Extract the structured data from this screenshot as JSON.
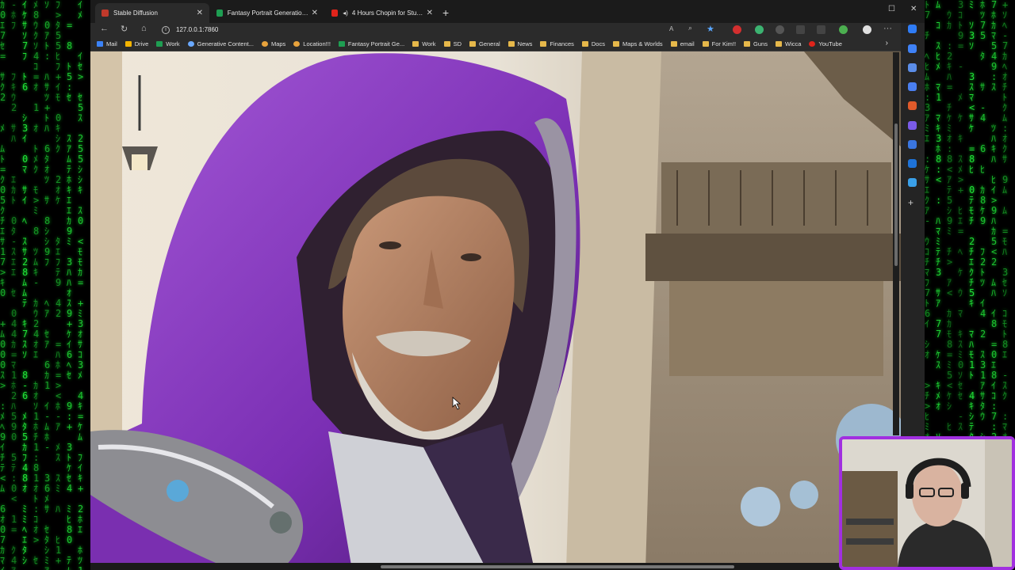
{
  "browser": {
    "tabs": [
      {
        "label": "Stable Diffusion",
        "active": true,
        "favicon": "stable-diffusion-icon"
      },
      {
        "label": "Fantasy Portrait Generation - Go...",
        "active": false,
        "favicon": "sheets-icon"
      },
      {
        "label": "4 Hours Chopin for Studyin...",
        "active": false,
        "favicon": "youtube-icon"
      }
    ],
    "new_tab_label": "+",
    "address": "127.0.0.1:7860",
    "bookmarks": [
      {
        "label": "Mail",
        "icon": "mail-icon"
      },
      {
        "label": "Drive",
        "icon": "drive-icon"
      },
      {
        "label": "Work",
        "icon": "sheets-icon"
      },
      {
        "label": "Generative Content...",
        "icon": "globe-icon"
      },
      {
        "label": "Maps",
        "icon": "maps-icon"
      },
      {
        "label": "Location!!!",
        "icon": "maps-icon"
      },
      {
        "label": "Fantasy Portrait Ge...",
        "icon": "sheets-icon"
      },
      {
        "label": "Work",
        "icon": "folder-icon"
      },
      {
        "label": "SD",
        "icon": "folder-icon"
      },
      {
        "label": "General",
        "icon": "folder-icon"
      },
      {
        "label": "News",
        "icon": "folder-icon"
      },
      {
        "label": "Finances",
        "icon": "folder-icon"
      },
      {
        "label": "Docs",
        "icon": "folder-icon"
      },
      {
        "label": "Maps & Worlds",
        "icon": "folder-icon"
      },
      {
        "label": "email",
        "icon": "folder-icon"
      },
      {
        "label": "For Kim!!",
        "icon": "folder-icon"
      },
      {
        "label": "Guns",
        "icon": "folder-icon"
      },
      {
        "label": "Wicca",
        "icon": "folder-icon"
      },
      {
        "label": "YouTube",
        "icon": "youtube-icon"
      }
    ]
  },
  "content": {
    "image_subject": "hooded-wizard-portrait"
  },
  "colors": {
    "matrix_green": "#22e63a",
    "robe_purple": "#8a3ec2",
    "webcam_border": "#a12fe0",
    "folder": "#e6b84a"
  }
}
